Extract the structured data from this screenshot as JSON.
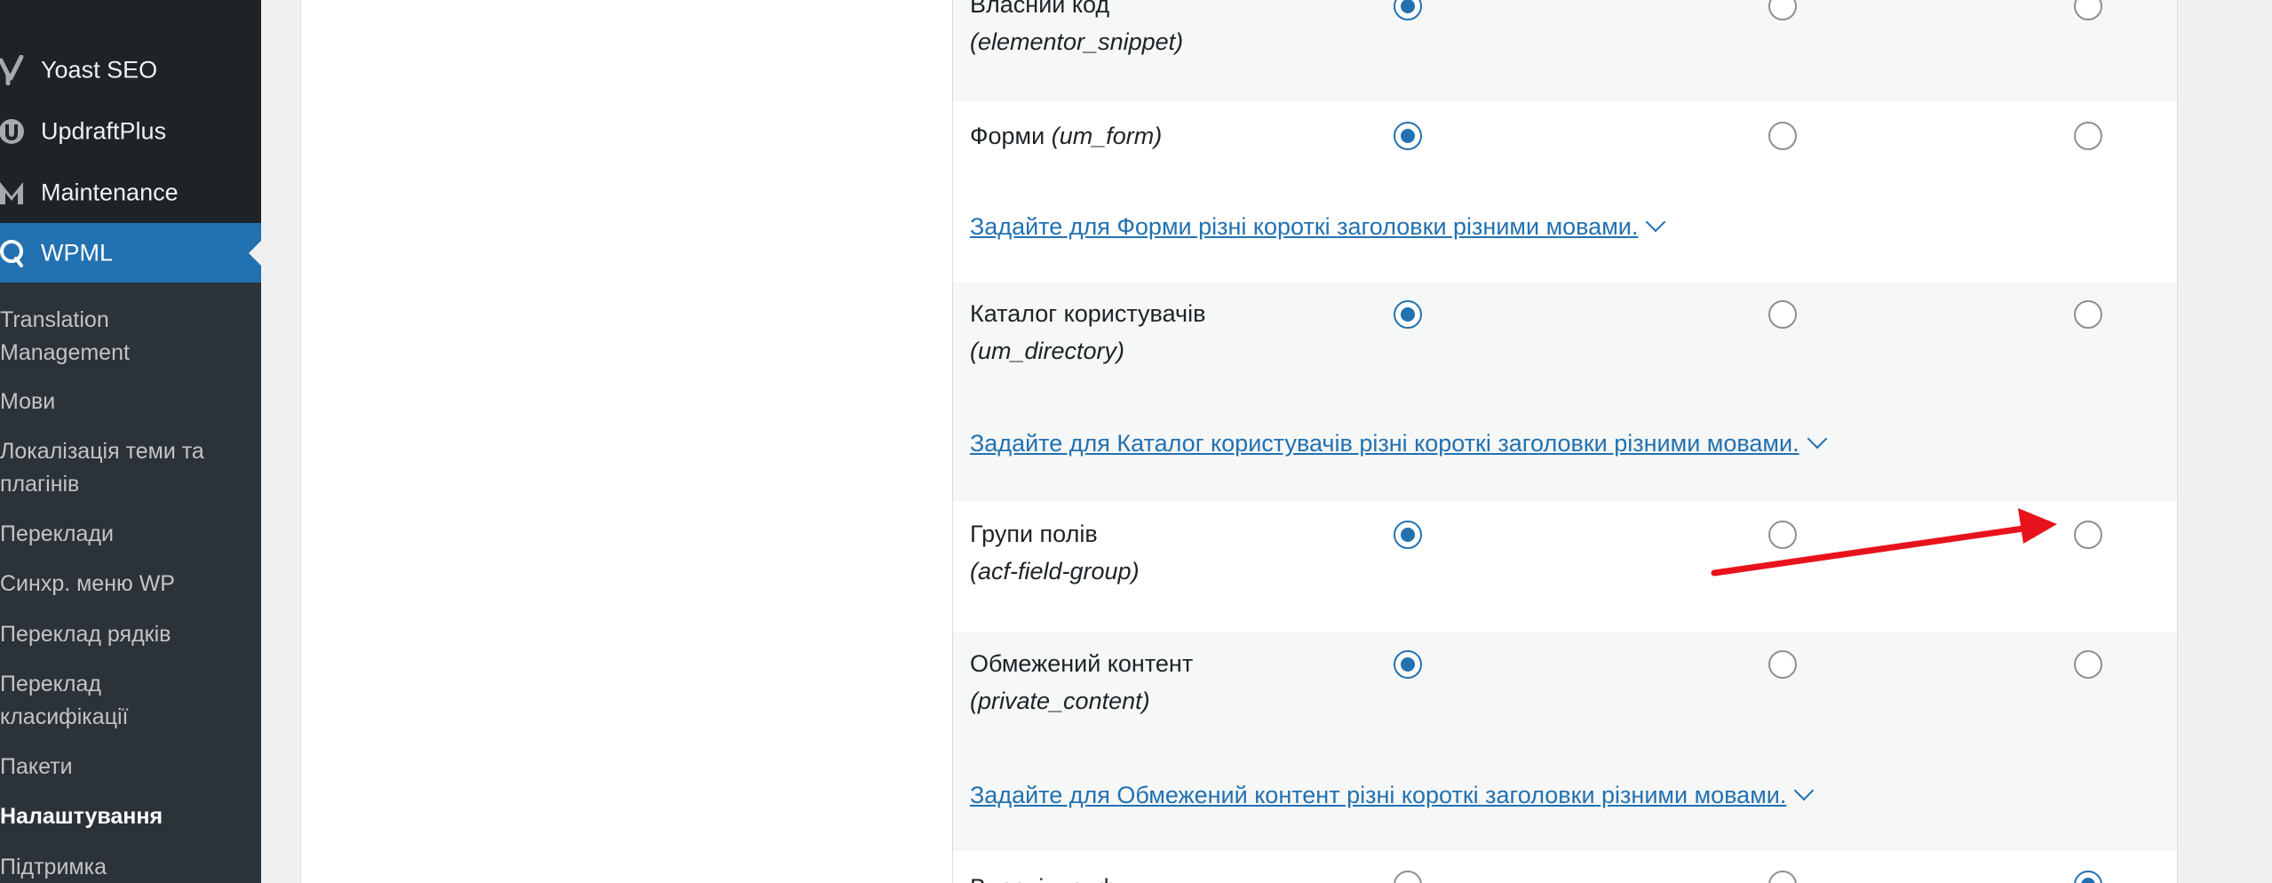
{
  "sidebar": {
    "menu": [
      {
        "label": "Yoast SEO",
        "icon": "yoast-icon"
      },
      {
        "label": "UpdraftPlus",
        "icon": "updraftplus-icon"
      },
      {
        "label": "Maintenance",
        "icon": "maintenance-icon"
      },
      {
        "label": "WPML",
        "icon": "wpml-icon",
        "active": true
      }
    ],
    "submenu": [
      {
        "label_line1": "Translation",
        "label_line2": "Management"
      },
      {
        "label_line1": "Мови"
      },
      {
        "label_line1": "Локалізація теми та",
        "label_line2": "плагінів"
      },
      {
        "label_line1": "Переклади"
      },
      {
        "label_line1": "Синхр. меню WP"
      },
      {
        "label_line1": "Переклад рядків"
      },
      {
        "label_line1": "Переклад",
        "label_line2": "класифікації"
      },
      {
        "label_line1": "Пакети"
      },
      {
        "label_line1": "Налаштування",
        "current": true
      },
      {
        "label_line1": "Підтримка"
      }
    ]
  },
  "table": {
    "rows": [
      {
        "name": "Власний код",
        "slug": "(elementor_snippet)",
        "selected": 1
      },
      {
        "name": "Форми",
        "slug": "(um_form)",
        "selected": 1,
        "link": "Задайте для Форми різні короткі заголовки різними мовами."
      },
      {
        "name": "Каталог користувачів",
        "slug": "(um_directory)",
        "selected": 1,
        "link": "Задайте для Каталог користувачів різні короткі заголовки різними мовами."
      },
      {
        "name": "Групи полів",
        "slug": "(acf-field-group)",
        "selected": 1
      },
      {
        "name": "Обмежений контент",
        "slug": "(private_content)",
        "selected": 1,
        "link": "Задайте для Обмежений контент різні короткі заголовки різними мовами."
      },
      {
        "name": "Власні шрифти",
        "slug": "",
        "selected": 3
      }
    ]
  },
  "colors": {
    "accent": "#2271b1",
    "sidebar_bg": "#1d2327",
    "submenu_bg": "#2c3338",
    "annotation_arrow": "#e8121c"
  }
}
